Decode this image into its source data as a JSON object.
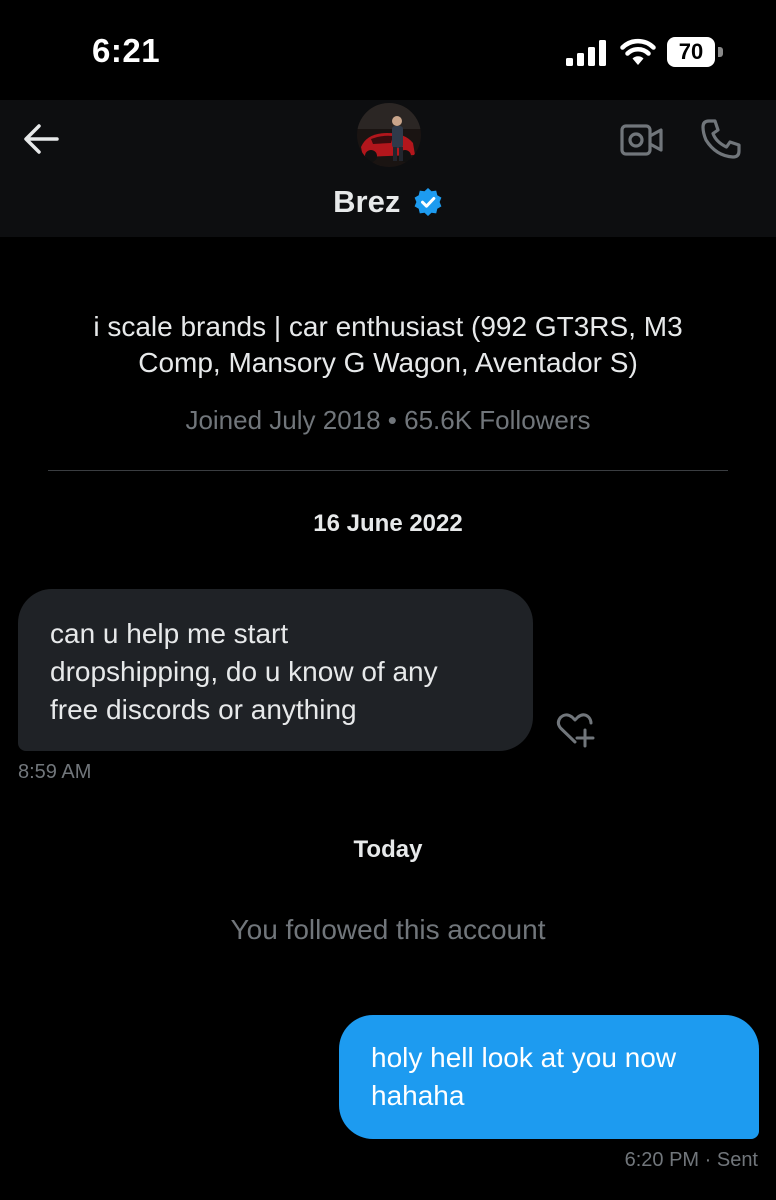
{
  "status_bar": {
    "time": "6:21",
    "battery": "70"
  },
  "header": {
    "name": "Brez",
    "verified": true
  },
  "profile": {
    "bio_line1": "i scale brands | car enthusiast (992 GT3RS, M3",
    "bio_line2": "Comp, Mansory G Wagon, Aventador S)",
    "meta": "Joined July 2018 • 65.6K Followers"
  },
  "conversation": {
    "date_header": "16 June 2022",
    "incoming": {
      "line1": "can u help me start",
      "line2": "dropshipping, do u know of any",
      "line3": "free discords or anything",
      "time": "8:59 AM"
    },
    "today_header": "Today",
    "system_notice": "You followed this account",
    "outgoing": {
      "line1": "holy hell look at you now",
      "line2": "hahaha",
      "status": "6:20 PM  · Sent"
    }
  },
  "colors": {
    "accent": "#1d9bf0",
    "incoming_bubble": "#1f2226",
    "muted": "#71767b"
  }
}
